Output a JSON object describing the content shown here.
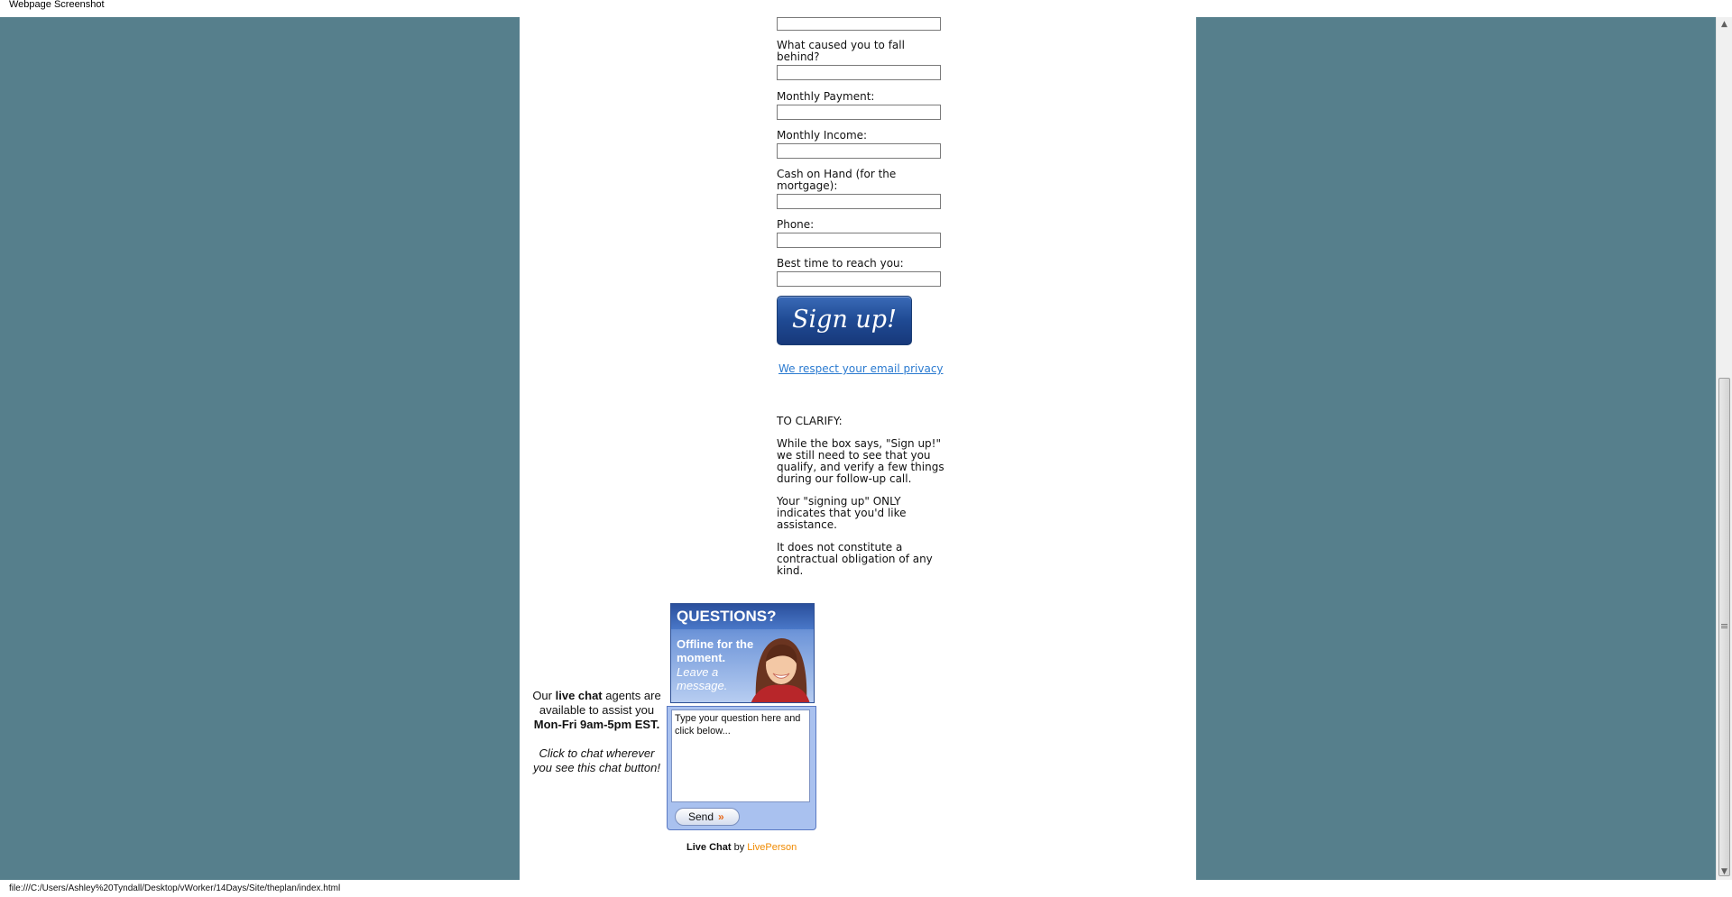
{
  "window": {
    "title": "Webpage Screenshot"
  },
  "form": {
    "fields": [
      {
        "label": "",
        "value": ""
      },
      {
        "label": "What caused you to fall behind?",
        "value": ""
      },
      {
        "label": "Monthly Payment:",
        "value": ""
      },
      {
        "label": "Monthly Income:",
        "value": ""
      },
      {
        "label": "Cash on Hand (for the mortgage):",
        "value": ""
      },
      {
        "label": "Phone:",
        "value": ""
      },
      {
        "label": "Best time to reach you:",
        "value": ""
      }
    ],
    "submit_label": "Sign up!",
    "privacy_link": "We respect your email privacy"
  },
  "clarify": {
    "heading": "TO CLARIFY:",
    "paragraphs": [
      "While the box says, \"Sign up!\" we still need to see that you qualify, and verify a few things during our follow-up call.",
      "Your \"signing up\" ONLY indicates that you'd like assistance.",
      "It does not constitute a contractual obligation of any kind."
    ]
  },
  "chat": {
    "aside_prefix": "Our ",
    "aside_bold": "live chat",
    "aside_suffix": " agents are available to assist you",
    "hours": "Mon-Fri 9am-5pm EST.",
    "cta": "Click to chat wherever you see this chat button!",
    "banner_title": "QUESTIONS?",
    "banner_status": "Offline for the moment.",
    "banner_action": "Leave a message.",
    "textarea_value": "Type your question here and click below...",
    "send_label": "Send",
    "send_arrows": "»",
    "credit_prefix": "Live Chat",
    "credit_by": " by ",
    "credit_brand": "LivePerson",
    "brand_color": "#f08a00"
  },
  "status_bar": {
    "url": "file:///C:/Users/Ashley%20Tyndall/Desktop/vWorker/14Days/Site/theplan/index.html"
  },
  "colors": {
    "page_background": "#567f8c",
    "link": "#2a7ad0",
    "button": "#1f4a93"
  }
}
